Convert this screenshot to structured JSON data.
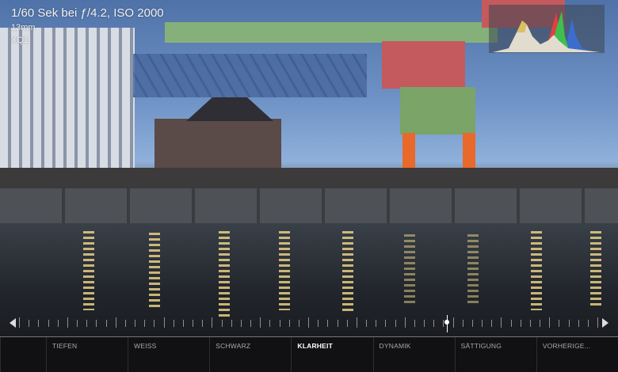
{
  "photo_info": {
    "exposure": "1/60 Sek bei ƒ/4.2, ISO 2000",
    "focal_length": "13mm",
    "camera": "XQ1"
  },
  "histogram": {
    "channels": [
      "red",
      "green",
      "blue",
      "luminance"
    ]
  },
  "slider": {
    "adjustment": "Klarheit",
    "value_fraction": 0.74
  },
  "toolbar": {
    "items": [
      {
        "label": "",
        "active": false
      },
      {
        "label": "TIEFEN",
        "active": false
      },
      {
        "label": "WEISS",
        "active": false
      },
      {
        "label": "SCHWARZ",
        "active": false
      },
      {
        "label": "KLARHEIT",
        "active": true
      },
      {
        "label": "DYNAMIK",
        "active": false
      },
      {
        "label": "SÄTTIGUNG",
        "active": false
      },
      {
        "label": "VORHERIGE...",
        "active": false
      }
    ]
  },
  "colors": {
    "accent": "#ffffff",
    "toolbar_bg": "#121214",
    "crane_green": "#7aa468",
    "crane_orange": "#e8692a"
  }
}
